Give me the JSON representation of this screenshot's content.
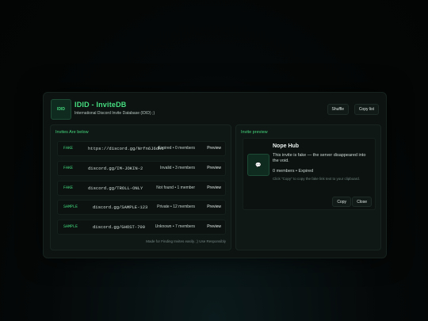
{
  "app": {
    "logo_text": "IDID",
    "title": "IDID - InviteDB",
    "subtitle": "International Discord Invite Database (IDID) ;)"
  },
  "header_buttons": {
    "shuffle": "Shuffle",
    "copy_list": "Copy list"
  },
  "invites": {
    "title": "Invites Are below",
    "preview_label": "Preview",
    "rows": [
      {
        "tag": "FAKE",
        "link": "https://discord.gg/Nrfn6J6dht",
        "status": "Expired • 0 members"
      },
      {
        "tag": "FAKE",
        "link": "discord.gg/IM-JOKIN-2",
        "status": "Invalid • 3 members"
      },
      {
        "tag": "FAKE",
        "link": "discord.gg/TROLL-ONLY",
        "status": "Not found • 1 member"
      },
      {
        "tag": "SAMPLE",
        "link": "discord.gg/SAMPLE-123",
        "status": "Private • 12 members"
      },
      {
        "tag": "SAMPLE",
        "link": "discord.gg/GHOST-700",
        "status": "Unknown • 7 members"
      }
    ],
    "footer": "Made for Finding Invites easily. ;) Use Responsibly"
  },
  "preview": {
    "title": "Invite preview",
    "avatar_icon": "speech-bubble-icon",
    "name": "Nope Hub",
    "description": "This invite is fake — the server disappeared into the void.",
    "meta": "0 members • Expired",
    "hint": "Click \"Copy\" to copy the fake link text to your clipboard.",
    "copy_label": "Copy",
    "close_label": "Close"
  },
  "colors": {
    "accent": "#43d67b",
    "background": "#050808",
    "card": "#0c1311"
  }
}
